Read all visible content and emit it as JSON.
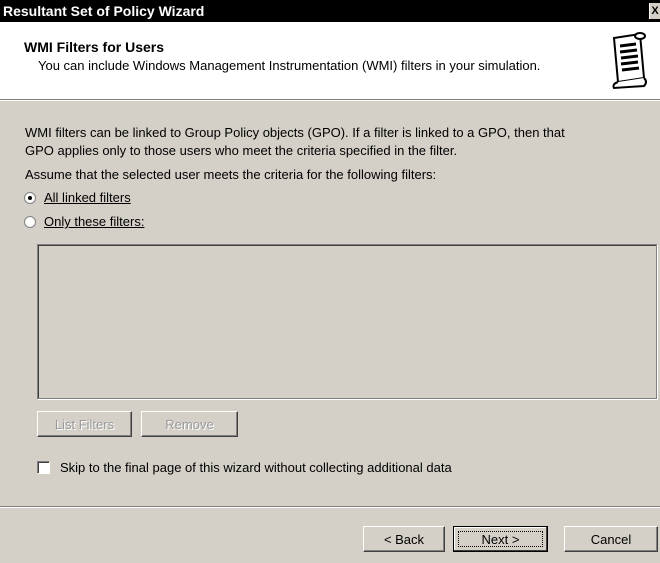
{
  "window": {
    "title": "Resultant Set of Policy Wizard",
    "close_glyph": "X"
  },
  "header": {
    "title": "WMI Filters for Users",
    "subtitle": "You can include Windows Management Instrumentation (WMI) filters in your simulation.",
    "icon": "scroll-document-icon"
  },
  "body": {
    "intro_line1": "WMI filters can be linked to Group Policy objects (GPO). If a filter is linked to a GPO, then that",
    "intro_line2": "GPO applies only to those users who meet the criteria specified in the filter.",
    "assume": "Assume that the selected user meets the criteria for the following filters:"
  },
  "options": {
    "all_linked": {
      "label": "All linked filters",
      "selected": true
    },
    "only_these": {
      "label": "Only these filters:",
      "selected": false
    }
  },
  "filter_list": {
    "items": []
  },
  "buttons": {
    "list_filters": "List Filters",
    "remove": "Remove",
    "back": "< Back",
    "next": "Next >",
    "cancel": "Cancel"
  },
  "skip": {
    "label": "Skip to the final page of this wizard without collecting additional data",
    "checked": false
  }
}
